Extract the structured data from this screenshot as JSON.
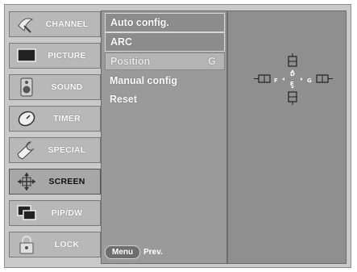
{
  "sidebar": {
    "items": [
      {
        "label": "CHANNEL",
        "icon": "satellite-dish-icon",
        "active": false
      },
      {
        "label": "PICTURE",
        "icon": "monitor-icon",
        "active": false
      },
      {
        "label": "SOUND",
        "icon": "speaker-icon",
        "active": false
      },
      {
        "label": "TIMER",
        "icon": "clock-icon",
        "active": false
      },
      {
        "label": "SPECIAL",
        "icon": "wrench-icon",
        "active": false
      },
      {
        "label": "SCREEN",
        "icon": "screen-adjust-icon",
        "active": true
      },
      {
        "label": "PIP/DW",
        "icon": "pip-icon",
        "active": false
      },
      {
        "label": "LOCK",
        "icon": "lock-icon",
        "active": false
      }
    ]
  },
  "menu": {
    "items": [
      {
        "label": "Auto config.",
        "key": ""
      },
      {
        "label": "ARC",
        "key": ""
      },
      {
        "label": "Position",
        "key": "G"
      },
      {
        "label": "Manual config",
        "key": ""
      },
      {
        "label": "Reset",
        "key": ""
      }
    ],
    "footer": {
      "button": "Menu",
      "text": "Prev."
    }
  },
  "position_diagram": {
    "labels": {
      "up": "D",
      "down": "E",
      "left": "F",
      "right": "G"
    }
  },
  "colors": {
    "background": "#c9c9c9",
    "menu_bg": "#9a9a9a",
    "panel_bg": "#8f8f8f",
    "text": "#ffffff"
  }
}
